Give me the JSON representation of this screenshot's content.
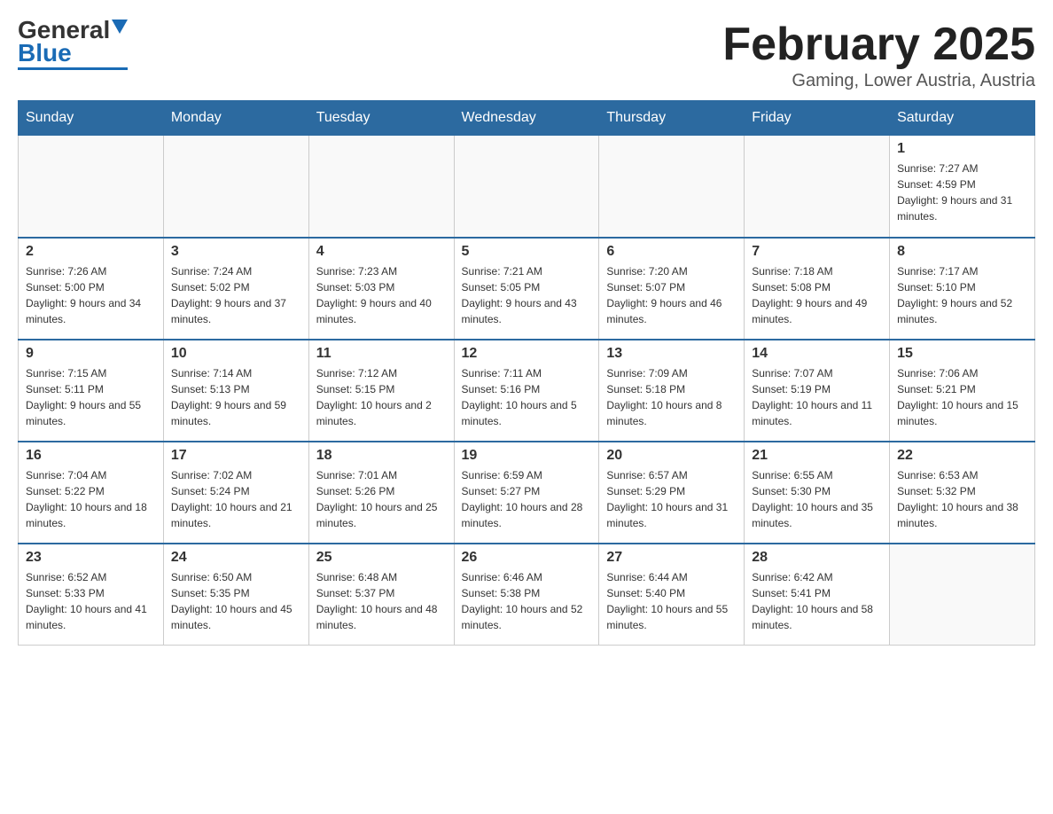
{
  "header": {
    "logo_text_black": "General",
    "logo_text_blue": "Blue",
    "title": "February 2025",
    "subtitle": "Gaming, Lower Austria, Austria"
  },
  "calendar": {
    "days_of_week": [
      "Sunday",
      "Monday",
      "Tuesday",
      "Wednesday",
      "Thursday",
      "Friday",
      "Saturday"
    ],
    "weeks": [
      [
        {
          "day": "",
          "info": ""
        },
        {
          "day": "",
          "info": ""
        },
        {
          "day": "",
          "info": ""
        },
        {
          "day": "",
          "info": ""
        },
        {
          "day": "",
          "info": ""
        },
        {
          "day": "",
          "info": ""
        },
        {
          "day": "1",
          "info": "Sunrise: 7:27 AM\nSunset: 4:59 PM\nDaylight: 9 hours and 31 minutes."
        }
      ],
      [
        {
          "day": "2",
          "info": "Sunrise: 7:26 AM\nSunset: 5:00 PM\nDaylight: 9 hours and 34 minutes."
        },
        {
          "day": "3",
          "info": "Sunrise: 7:24 AM\nSunset: 5:02 PM\nDaylight: 9 hours and 37 minutes."
        },
        {
          "day": "4",
          "info": "Sunrise: 7:23 AM\nSunset: 5:03 PM\nDaylight: 9 hours and 40 minutes."
        },
        {
          "day": "5",
          "info": "Sunrise: 7:21 AM\nSunset: 5:05 PM\nDaylight: 9 hours and 43 minutes."
        },
        {
          "day": "6",
          "info": "Sunrise: 7:20 AM\nSunset: 5:07 PM\nDaylight: 9 hours and 46 minutes."
        },
        {
          "day": "7",
          "info": "Sunrise: 7:18 AM\nSunset: 5:08 PM\nDaylight: 9 hours and 49 minutes."
        },
        {
          "day": "8",
          "info": "Sunrise: 7:17 AM\nSunset: 5:10 PM\nDaylight: 9 hours and 52 minutes."
        }
      ],
      [
        {
          "day": "9",
          "info": "Sunrise: 7:15 AM\nSunset: 5:11 PM\nDaylight: 9 hours and 55 minutes."
        },
        {
          "day": "10",
          "info": "Sunrise: 7:14 AM\nSunset: 5:13 PM\nDaylight: 9 hours and 59 minutes."
        },
        {
          "day": "11",
          "info": "Sunrise: 7:12 AM\nSunset: 5:15 PM\nDaylight: 10 hours and 2 minutes."
        },
        {
          "day": "12",
          "info": "Sunrise: 7:11 AM\nSunset: 5:16 PM\nDaylight: 10 hours and 5 minutes."
        },
        {
          "day": "13",
          "info": "Sunrise: 7:09 AM\nSunset: 5:18 PM\nDaylight: 10 hours and 8 minutes."
        },
        {
          "day": "14",
          "info": "Sunrise: 7:07 AM\nSunset: 5:19 PM\nDaylight: 10 hours and 11 minutes."
        },
        {
          "day": "15",
          "info": "Sunrise: 7:06 AM\nSunset: 5:21 PM\nDaylight: 10 hours and 15 minutes."
        }
      ],
      [
        {
          "day": "16",
          "info": "Sunrise: 7:04 AM\nSunset: 5:22 PM\nDaylight: 10 hours and 18 minutes."
        },
        {
          "day": "17",
          "info": "Sunrise: 7:02 AM\nSunset: 5:24 PM\nDaylight: 10 hours and 21 minutes."
        },
        {
          "day": "18",
          "info": "Sunrise: 7:01 AM\nSunset: 5:26 PM\nDaylight: 10 hours and 25 minutes."
        },
        {
          "day": "19",
          "info": "Sunrise: 6:59 AM\nSunset: 5:27 PM\nDaylight: 10 hours and 28 minutes."
        },
        {
          "day": "20",
          "info": "Sunrise: 6:57 AM\nSunset: 5:29 PM\nDaylight: 10 hours and 31 minutes."
        },
        {
          "day": "21",
          "info": "Sunrise: 6:55 AM\nSunset: 5:30 PM\nDaylight: 10 hours and 35 minutes."
        },
        {
          "day": "22",
          "info": "Sunrise: 6:53 AM\nSunset: 5:32 PM\nDaylight: 10 hours and 38 minutes."
        }
      ],
      [
        {
          "day": "23",
          "info": "Sunrise: 6:52 AM\nSunset: 5:33 PM\nDaylight: 10 hours and 41 minutes."
        },
        {
          "day": "24",
          "info": "Sunrise: 6:50 AM\nSunset: 5:35 PM\nDaylight: 10 hours and 45 minutes."
        },
        {
          "day": "25",
          "info": "Sunrise: 6:48 AM\nSunset: 5:37 PM\nDaylight: 10 hours and 48 minutes."
        },
        {
          "day": "26",
          "info": "Sunrise: 6:46 AM\nSunset: 5:38 PM\nDaylight: 10 hours and 52 minutes."
        },
        {
          "day": "27",
          "info": "Sunrise: 6:44 AM\nSunset: 5:40 PM\nDaylight: 10 hours and 55 minutes."
        },
        {
          "day": "28",
          "info": "Sunrise: 6:42 AM\nSunset: 5:41 PM\nDaylight: 10 hours and 58 minutes."
        },
        {
          "day": "",
          "info": ""
        }
      ]
    ]
  }
}
